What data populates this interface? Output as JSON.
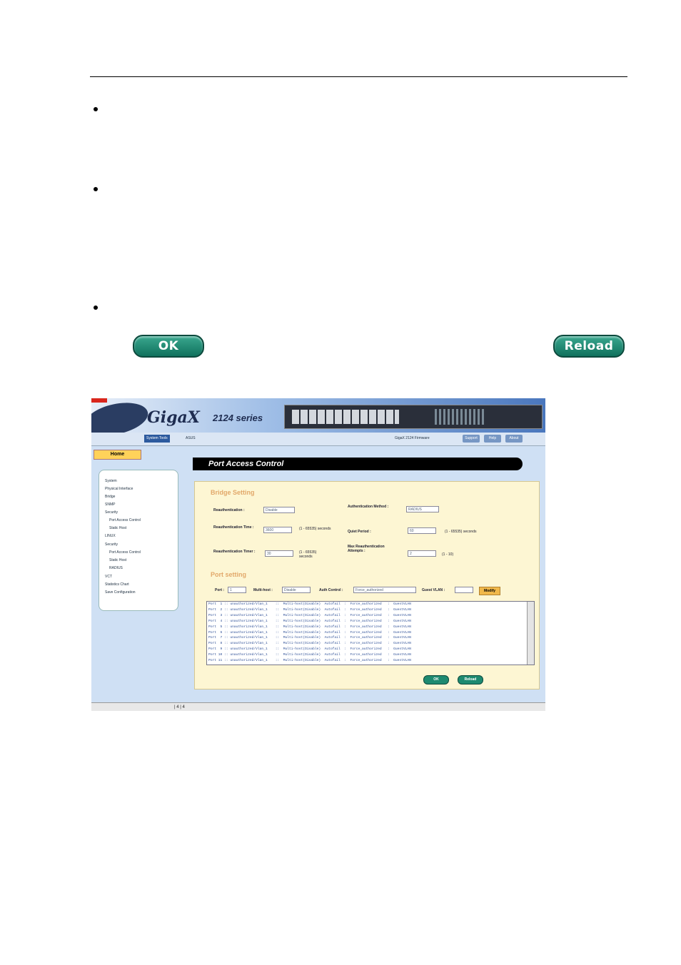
{
  "doc": {
    "buttons": {
      "ok": "OK",
      "reload": "Reload"
    }
  },
  "screenshot": {
    "banner": {
      "logo": "GigaX",
      "series": "2124 series"
    },
    "toolbar": {
      "tab": "System Tools",
      "context": "ASUS",
      "info": "GigaX 2124 Firmware",
      "btn_support": "Support",
      "btn_help": "Help",
      "btn_about": "About"
    },
    "home_tab": "Home",
    "nav": {
      "items": [
        "System",
        "Physical Interface",
        "Bridge",
        "SNMP",
        "Security",
        "Port Access Control",
        "Static Host",
        "LINUX",
        "Security",
        "Port Access Control",
        "Static Host",
        "RADIUS",
        "VCT",
        "Statistics Chart",
        "Save Configuration"
      ]
    },
    "page_title": "Port Access Control",
    "bridge_setting": {
      "title": "Bridge Setting",
      "reauth_label": "Reauthentication :",
      "reauth_value": "Disable",
      "auth_method_label": "Authentication Method :",
      "auth_method_value": "RADIUS",
      "reauth_time_label": "Reauthentication Time :",
      "reauth_time_value": "3600",
      "reauth_time_hint": "(1 - 65535) seconds",
      "quiet_period_label": "Quiet Period :",
      "quiet_period_value": "60",
      "quiet_period_hint": "(1 - 65535) seconds",
      "reauth_timeout_label": "Reauthentication Timer :",
      "reauth_timeout_value": "30",
      "reauth_timeout_hint": "(1 - 65535) seconds",
      "max_reauth_label": "Max Reauthentication Attempts :",
      "max_reauth_value": "2",
      "max_reauth_hint": "(1 - 10)"
    },
    "port_setting": {
      "title": "Port setting",
      "port_label": "Port :",
      "port_value": "1",
      "multi_host_label": "Multi-host :",
      "multi_host_value": "Disable",
      "auth_control_label": "Auth Control :",
      "auth_control_value": "Force_authorized",
      "guest_vlan_label": "Guest VLAN :",
      "guest_vlan_value": "",
      "modify_label": "Modify"
    },
    "list_rows": [
      "Port  1 :: unauthorized/Vlan_1    ::  Multi-host(Disable)  Autofail  :  Force_authorized   :  GuestVLAN",
      "Port  2 :: unauthorized/Vlan_1    ::  Multi-host(Disable)  Autofail  :  Force_authorized   :  GuestVLAN",
      "Port  3 :: unauthorized/Vlan_1    ::  Multi-host(Disable)  Autofail  :  Force_authorized   :  GuestVLAN",
      "Port  4 :: unauthorized/Vlan_1    ::  Multi-host(Disable)  Autofail  :  Force_authorized   :  GuestVLAN",
      "Port  5 :: unauthorized/Vlan_1    ::  Multi-host(Disable)  Autofail  :  Force_authorized   :  GuestVLAN",
      "Port  6 :: unauthorized/Vlan_1    ::  Multi-host(Disable)  Autofail  :  Force_authorized   :  GuestVLAN",
      "Port  7 :: unauthorized/Vlan_1    ::  Multi-host(Disable)  Autofail  :  Force_authorized   :  GuestVLAN",
      "Port  8 :: unauthorized/Vlan_1    ::  Multi-host(Disable)  Autofail  :  Force_authorized   :  GuestVLAN",
      "Port  9 :: unauthorized/Vlan_1    ::  Multi-host(Disable)  Autofail  :  Force_authorized   :  GuestVLAN",
      "Port 10 :: unauthorized/Vlan_1    ::  Multi-host(Disable)  Autofail  :  Force_authorized   :  GuestVLAN",
      "Port 11 :: unauthorized/Vlan_1    ::  Multi-host(Disable)  Autofail  :  Force_authorized   :  GuestVLAN"
    ],
    "ok_label": "OK",
    "reload_label": "Reload",
    "status_text": "| 4 | 4"
  }
}
